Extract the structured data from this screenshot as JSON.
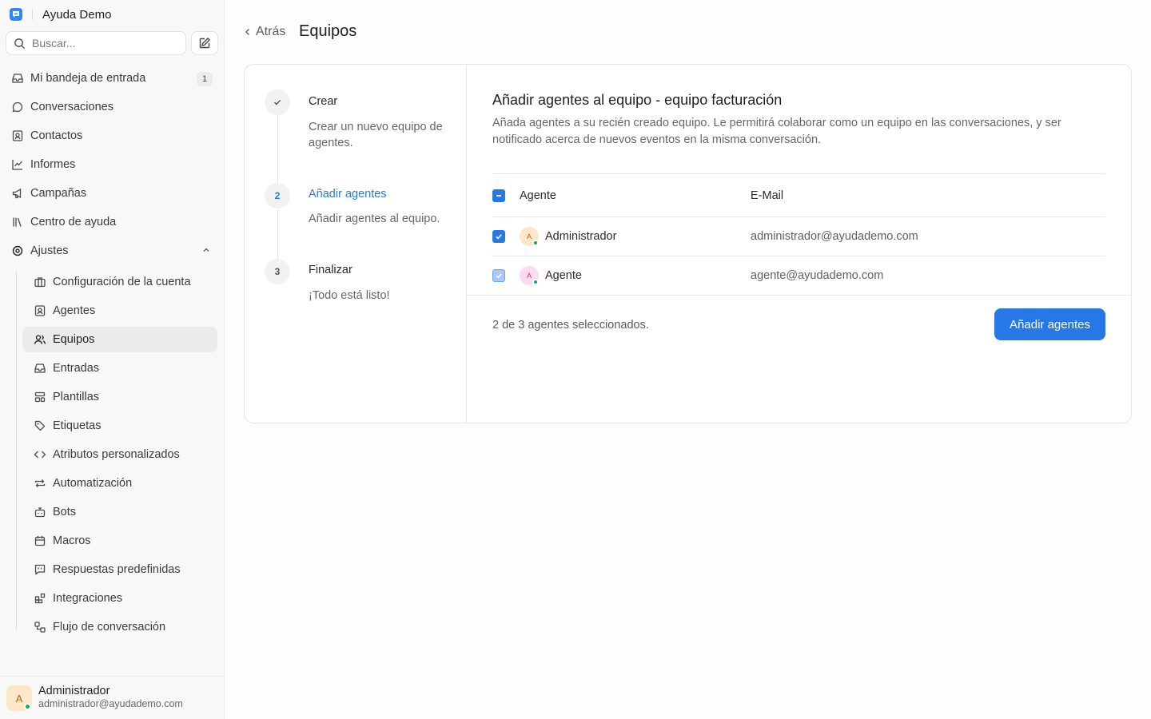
{
  "app": {
    "name": "Ayuda Demo",
    "logo_icon": "chat-bubble-logo-icon"
  },
  "search": {
    "placeholder": "Buscar..."
  },
  "sidebar": {
    "items": [
      {
        "label": "Mi bandeja de entrada",
        "icon": "inbox-icon",
        "badge": "1"
      },
      {
        "label": "Conversaciones",
        "icon": "chat-bubble-icon"
      },
      {
        "label": "Contactos",
        "icon": "contact-card-icon"
      },
      {
        "label": "Informes",
        "icon": "line-chart-icon"
      },
      {
        "label": "Campañas",
        "icon": "megaphone-icon"
      },
      {
        "label": "Centro de ayuda",
        "icon": "library-icon"
      },
      {
        "label": "Ajustes",
        "icon": "gear-icon",
        "expanded": true
      }
    ],
    "settings_items": [
      {
        "label": "Configuración de la cuenta",
        "icon": "briefcase-icon"
      },
      {
        "label": "Agentes",
        "icon": "contact-card-icon"
      },
      {
        "label": "Equipos",
        "icon": "users-icon",
        "active": true
      },
      {
        "label": "Entradas",
        "icon": "inbox-icon"
      },
      {
        "label": "Plantillas",
        "icon": "layout-template-icon"
      },
      {
        "label": "Etiquetas",
        "icon": "tag-icon"
      },
      {
        "label": "Atributos personalizados",
        "icon": "code-icon"
      },
      {
        "label": "Automatización",
        "icon": "arrows-repeat-icon"
      },
      {
        "label": "Bots",
        "icon": "bot-icon"
      },
      {
        "label": "Macros",
        "icon": "calendar-icon"
      },
      {
        "label": "Respuestas predefinidas",
        "icon": "quote-message-icon"
      },
      {
        "label": "Integraciones",
        "icon": "blocks-icon"
      },
      {
        "label": "Flujo de conversación",
        "icon": "workflow-icon"
      }
    ]
  },
  "profile": {
    "initial": "A",
    "name": "Administrador",
    "email": "administrador@ayudademo.com",
    "status": "online"
  },
  "header": {
    "back_label": "Atrás",
    "title": "Equipos"
  },
  "steps": [
    {
      "marker": "✓",
      "title": "Crear",
      "description": "Crear un nuevo equipo de agentes.",
      "state": "done"
    },
    {
      "marker": "2",
      "title": "Añadir agentes",
      "description": "Añadir agentes al equipo.",
      "state": "current"
    },
    {
      "marker": "3",
      "title": "Finalizar",
      "description": "¡Todo está listo!",
      "state": "pending"
    }
  ],
  "panel": {
    "title": "Añadir agentes al equipo - equipo facturación",
    "description": "Añada agentes a su recién creado equipo. Le permitirá colaborar como un equipo en las conversaciones, y ser notificado acerca de nuevos eventos en la misma conversación.",
    "table": {
      "columns": [
        "Agente",
        "E-Mail"
      ],
      "header_checkbox": "indeterminate",
      "rows": [
        {
          "initial": "A",
          "name": "Administrador",
          "email": "administrador@ayudademo.com",
          "checked": true,
          "status": "online"
        },
        {
          "initial": "A",
          "name": "Agente",
          "email": "agente@ayudademo.com",
          "checked": true,
          "status": "online"
        }
      ]
    },
    "selected_text": "2 de 3 agentes seleccionados.",
    "submit_label": "Añadir agentes"
  },
  "colors": {
    "accent": "#2778e6",
    "online": "#15a86b",
    "brand": "#2f86f6"
  }
}
